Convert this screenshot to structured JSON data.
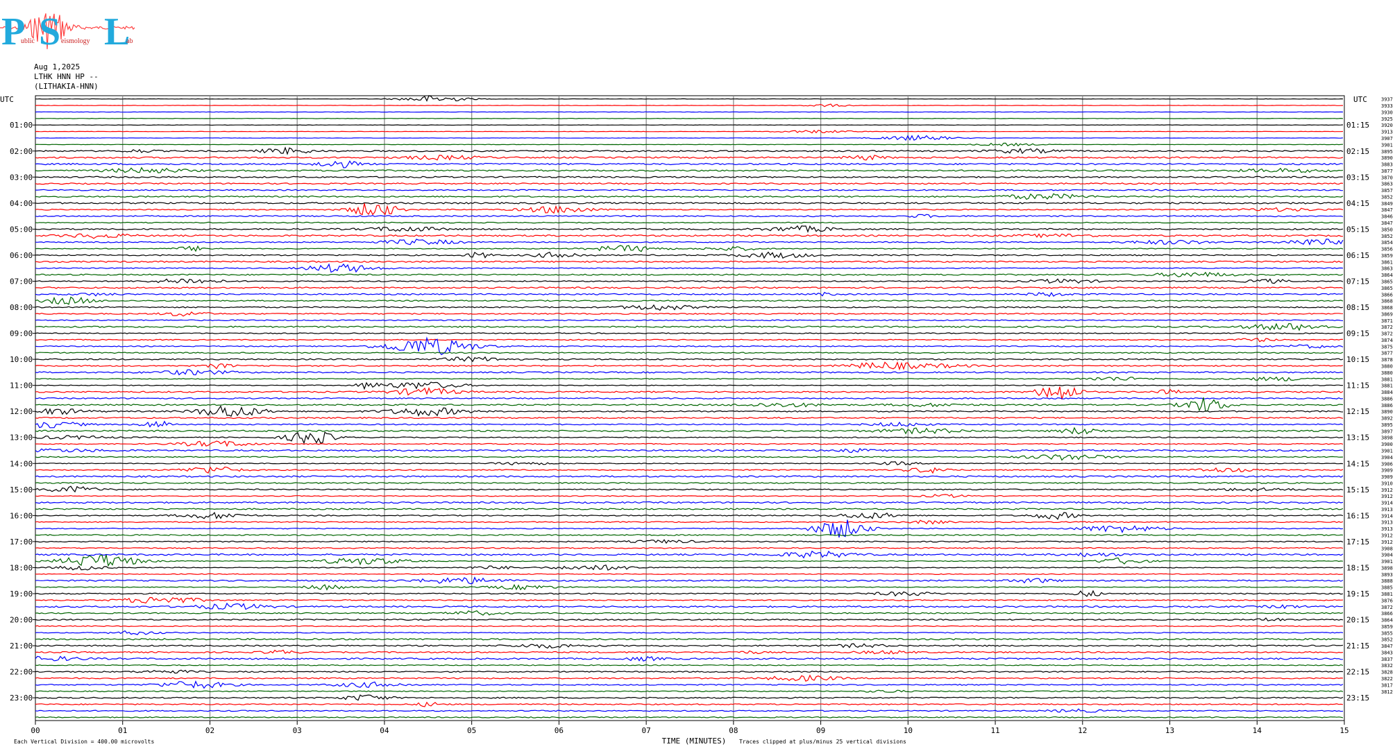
{
  "logo": {
    "letters": [
      "P",
      "S",
      "L"
    ],
    "words": [
      "ublic",
      "eismology",
      "ab"
    ]
  },
  "header": {
    "date": "Aug 1,2025",
    "station": "LTHK HNN HP --",
    "location": "(LITHAKIA-HNN)"
  },
  "chart_data": {
    "type": "line",
    "xlabel": "TIME (MINUTES)",
    "xlim": [
      0,
      15
    ],
    "xticks": [
      "00",
      "01",
      "02",
      "03",
      "04",
      "05",
      "06",
      "07",
      "08",
      "09",
      "10",
      "11",
      "12",
      "13",
      "14",
      "15"
    ],
    "left_axis_title": "UTC",
    "right_axis_title": "UTC",
    "left_hour_labels": [
      "01:00",
      "02:00",
      "03:00",
      "04:00",
      "05:00",
      "06:00",
      "07:00",
      "08:00",
      "09:00",
      "10:00",
      "11:00",
      "12:00",
      "13:00",
      "14:00",
      "15:00",
      "16:00",
      "17:00",
      "18:00",
      "19:00",
      "20:00",
      "21:00",
      "22:00",
      "23:00"
    ],
    "right_hour_labels": [
      "01:15",
      "02:15",
      "03:15",
      "04:15",
      "05:15",
      "06:15",
      "07:15",
      "08:15",
      "09:15",
      "10:15",
      "11:15",
      "12:15",
      "13:15",
      "14:15",
      "15:15",
      "16:15",
      "17:15",
      "18:15",
      "19:15",
      "20:15",
      "21:15",
      "22:15",
      "23:15"
    ],
    "trace_count": 96,
    "traces_per_hour": 4,
    "series_colors": [
      "#000000",
      "#ff0000",
      "#0000ff",
      "#006400"
    ],
    "right_trace_values": [
      "3937",
      "3933",
      "3930",
      "3925",
      "3920",
      "3913",
      "3907",
      "3901",
      "3895",
      "3890",
      "3883",
      "3877",
      "3870",
      "3863",
      "3857",
      "3852",
      "3849",
      "3847",
      "3846",
      "3847",
      "3850",
      "3852",
      "3854",
      "3856",
      "3859",
      "3861",
      "3863",
      "3864",
      "3865",
      "3865",
      "3866",
      "3868",
      "3868",
      "3869",
      "3871",
      "3872",
      "3872",
      "3874",
      "3875",
      "3877",
      "3878",
      "3880",
      "3880",
      "3881",
      "3881",
      "3884",
      "3886",
      "3886",
      "3890",
      "3892",
      "3895",
      "3897",
      "3898",
      "3900",
      "3901",
      "3904",
      "3906",
      "3909",
      "3909",
      "3910",
      "3912",
      "3912",
      "3914",
      "3913",
      "3914",
      "3913",
      "3913",
      "3912",
      "3912",
      "3908",
      "3904",
      "3901",
      "3898",
      "3893",
      "3888",
      "3885",
      "3881",
      "3876",
      "3872",
      "3866",
      "3864",
      "3859",
      "3855",
      "3852",
      "3847",
      "3843",
      "3837",
      "3832",
      "3828",
      "3822",
      "3817",
      "3812"
    ],
    "footer_left": "Each Vertical Division =  400.00 microvolts",
    "footer_right": "Traces clipped at plus/minus 25 vertical divisions"
  }
}
